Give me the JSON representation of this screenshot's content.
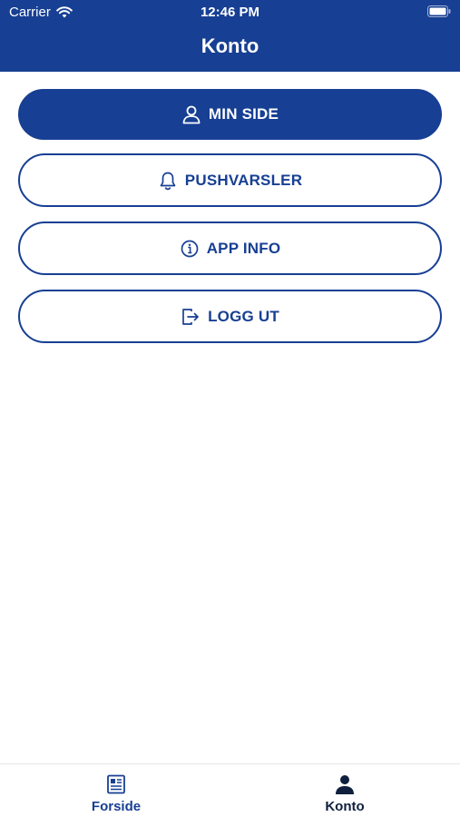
{
  "status_bar": {
    "carrier": "Carrier",
    "time": "12:46 PM"
  },
  "header": {
    "title": "Konto"
  },
  "menu": {
    "items": [
      {
        "label": "MIN SIDE",
        "icon": "user-icon"
      },
      {
        "label": "PUSHVARSLER",
        "icon": "bell-icon"
      },
      {
        "label": "APP INFO",
        "icon": "info-icon"
      },
      {
        "label": "LOGG UT",
        "icon": "logout-icon"
      }
    ]
  },
  "tabbar": {
    "tabs": [
      {
        "label": "Forside",
        "icon": "newspaper-icon"
      },
      {
        "label": "Konto",
        "icon": "person-icon"
      }
    ]
  },
  "colors": {
    "brand": "#173f93",
    "active_tab": "#0f1f3d"
  }
}
